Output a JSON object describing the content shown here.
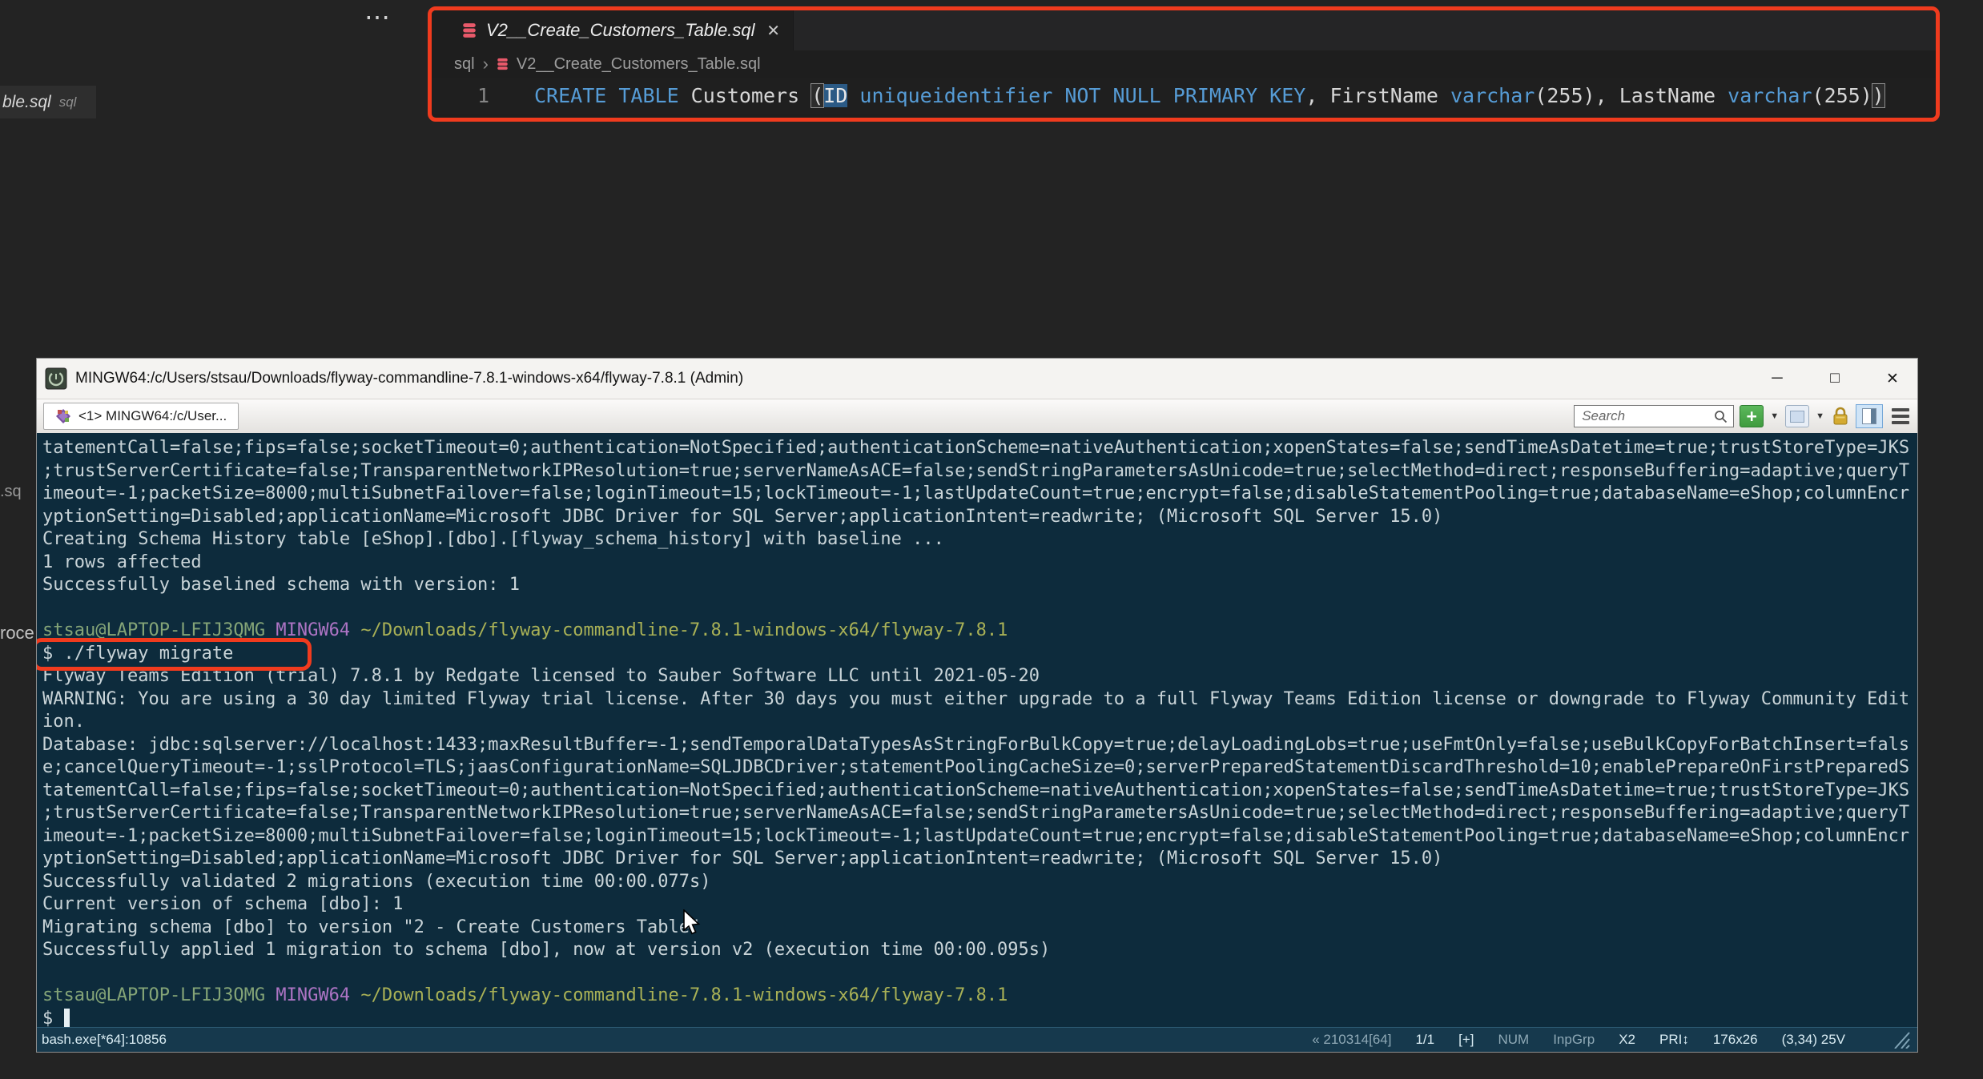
{
  "fragments": {
    "partial_tab_filename": "ble.sql",
    "partial_tab_lang": "sql",
    "left_mid": ".sq",
    "left_lower": "roce"
  },
  "editor": {
    "actions_ellipsis": "⋯",
    "tab": {
      "filename": "V2__Create_Customers_Table.sql",
      "close_glyph": "✕"
    },
    "breadcrumb": {
      "folder": "sql",
      "separator": "›",
      "filename": "V2__Create_Customers_Table.sql"
    },
    "line_number": "1",
    "code_tokens": [
      {
        "text": "CREATE TABLE ",
        "c": "kw"
      },
      {
        "text": "Customers ",
        "c": "id"
      },
      {
        "text": "(",
        "c": "br"
      },
      {
        "text": "ID",
        "c": "sel"
      },
      {
        "text": " ",
        "c": "id"
      },
      {
        "text": "uniqueidentifier",
        "c": "kw"
      },
      {
        "text": " ",
        "c": "id"
      },
      {
        "text": "NOT NULL PRIMARY KEY",
        "c": "kw"
      },
      {
        "text": ", FirstName ",
        "c": "id"
      },
      {
        "text": "varchar",
        "c": "kw"
      },
      {
        "text": "(255)",
        "c": "id"
      },
      {
        "text": ", LastName ",
        "c": "id"
      },
      {
        "text": "varchar",
        "c": "kw"
      },
      {
        "text": "(255)",
        "c": "id"
      },
      {
        "text": ")",
        "c": "br"
      }
    ]
  },
  "terminal": {
    "title": "MINGW64:/c/Users/stsau/Downloads/flyway-commandline-7.8.1-windows-x64/flyway-7.8.1 (Admin)",
    "window_buttons": {
      "minimize": "─",
      "maximize": "□",
      "close": "✕"
    },
    "tab_label": "<1> MINGW64:/c/User...",
    "search": {
      "placeholder": "Search"
    },
    "toolbar": {
      "plus_label": "+",
      "caret_glyph": "▼"
    },
    "prompt_parts": [
      {
        "text": "stsau@LAPTOP-LFIJ3QMG",
        "c": "user"
      },
      {
        "text": " ",
        "c": "plain"
      },
      {
        "text": "MINGW64",
        "c": "env"
      },
      {
        "text": " ",
        "c": "plain"
      },
      {
        "text": "~/Downloads/flyway-commandline-7.8.1-windows-x64/flyway-7.8.1",
        "c": "path"
      }
    ],
    "lines": [
      {
        "t": "plain",
        "text": "tatementCall=false;fips=false;socketTimeout=0;authentication=NotSpecified;authenticationScheme=nativeAuthentication;xopenStates=false;sendTimeAsDatetime=true;trustStoreType=JKS"
      },
      {
        "t": "plain",
        "text": ";trustServerCertificate=false;TransparentNetworkIPResolution=true;serverNameAsACE=false;sendStringParametersAsUnicode=true;selectMethod=direct;responseBuffering=adaptive;queryT"
      },
      {
        "t": "plain",
        "text": "imeout=-1;packetSize=8000;multiSubnetFailover=false;loginTimeout=15;lockTimeout=-1;lastUpdateCount=true;encrypt=false;disableStatementPooling=true;databaseName=eShop;columnEncr"
      },
      {
        "t": "plain",
        "text": "yptionSetting=Disabled;applicationName=Microsoft JDBC Driver for SQL Server;applicationIntent=readwrite; (Microsoft SQL Server 15.0)"
      },
      {
        "t": "plain",
        "text": "Creating Schema History table [eShop].[dbo].[flyway_schema_history] with baseline ..."
      },
      {
        "t": "plain",
        "text": "1 rows affected"
      },
      {
        "t": "plain",
        "text": "Successfully baselined schema with version: 1"
      },
      {
        "t": "blank"
      },
      {
        "t": "prompt"
      },
      {
        "t": "cmd",
        "text": "$ ./flyway migrate",
        "boxed": true
      },
      {
        "t": "plain",
        "text": "Flyway Teams Edition (trial) 7.8.1 by Redgate licensed to Sauber Software LLC until 2021-05-20"
      },
      {
        "t": "plain",
        "text": "WARNING: You are using a 30 day limited Flyway trial license. After 30 days you must either upgrade to a full Flyway Teams Edition license or downgrade to Flyway Community Edit"
      },
      {
        "t": "plain",
        "text": "ion."
      },
      {
        "t": "plain",
        "text": "Database: jdbc:sqlserver://localhost:1433;maxResultBuffer=-1;sendTemporalDataTypesAsStringForBulkCopy=true;delayLoadingLobs=true;useFmtOnly=false;useBulkCopyForBatchInsert=fals"
      },
      {
        "t": "plain",
        "text": "e;cancelQueryTimeout=-1;sslProtocol=TLS;jaasConfigurationName=SQLJDBCDriver;statementPoolingCacheSize=0;serverPreparedStatementDiscardThreshold=10;enablePrepareOnFirstPreparedS"
      },
      {
        "t": "plain",
        "text": "tatementCall=false;fips=false;socketTimeout=0;authentication=NotSpecified;authenticationScheme=nativeAuthentication;xopenStates=false;sendTimeAsDatetime=true;trustStoreType=JKS"
      },
      {
        "t": "plain",
        "text": ";trustServerCertificate=false;TransparentNetworkIPResolution=true;serverNameAsACE=false;sendStringParametersAsUnicode=true;selectMethod=direct;responseBuffering=adaptive;queryT"
      },
      {
        "t": "plain",
        "text": "imeout=-1;packetSize=8000;multiSubnetFailover=false;loginTimeout=15;lockTimeout=-1;lastUpdateCount=true;encrypt=false;disableStatementPooling=true;databaseName=eShop;columnEncr"
      },
      {
        "t": "plain",
        "text": "yptionSetting=Disabled;applicationName=Microsoft JDBC Driver for SQL Server;applicationIntent=readwrite; (Microsoft SQL Server 15.0)"
      },
      {
        "t": "plain",
        "text": "Successfully validated 2 migrations (execution time 00:00.077s)"
      },
      {
        "t": "plain",
        "text": "Current version of schema [dbo]: 1"
      },
      {
        "t": "plain",
        "text": "Migrating schema [dbo] to version \"2 - Create Customers Table\""
      },
      {
        "t": "plain",
        "text": "Successfully applied 1 migration to schema [dbo], now at version v2 (execution time 00:00.095s)"
      },
      {
        "t": "blank"
      },
      {
        "t": "prompt"
      },
      {
        "t": "cursor",
        "text": "$ "
      }
    ],
    "status_left": "bash.exe[*64]:10856",
    "status_right": [
      {
        "text": "« 210314[64]",
        "dim": true
      },
      {
        "text": "1/1"
      },
      {
        "text": "[+]"
      },
      {
        "text": "NUM",
        "dim": true
      },
      {
        "text": "InpGrp",
        "dim": true
      },
      {
        "text": "X2"
      },
      {
        "text": "PRI↕"
      },
      {
        "text": "176x26"
      },
      {
        "text": "(3,34) 25V"
      }
    ]
  },
  "colors": {
    "annotation_red": "#f03b1e",
    "terminal_background": "#0d2b3c",
    "keyword_blue": "#569cd6",
    "prompt_user_green": "#84a477",
    "prompt_env_magenta": "#ad74c4",
    "prompt_path_olive": "#a9b156"
  }
}
